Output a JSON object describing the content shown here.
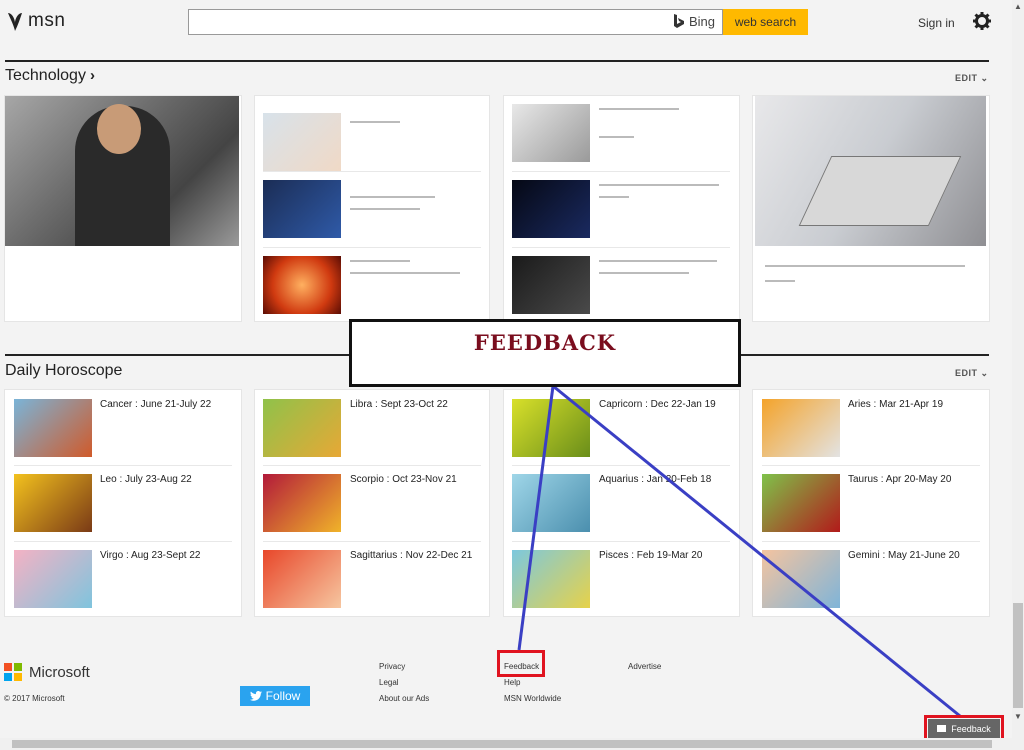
{
  "header": {
    "logo_text": "msn",
    "search_value": "",
    "bing_label": "Bing",
    "search_button": "web search",
    "signin": "Sign in"
  },
  "technology": {
    "title": "Technology",
    "edit": "EDIT"
  },
  "horoscope": {
    "title": "Daily Horoscope",
    "edit": "EDIT",
    "signs": [
      {
        "label": "Cancer : June 21-July 22"
      },
      {
        "label": "Leo : July 23-Aug 22"
      },
      {
        "label": "Virgo : Aug 23-Sept 22"
      },
      {
        "label": "Libra : Sept 23-Oct 22"
      },
      {
        "label": "Scorpio : Oct 23-Nov 21"
      },
      {
        "label": "Sagittarius : Nov 22-Dec 21"
      },
      {
        "label": "Capricorn : Dec 22-Jan 19"
      },
      {
        "label": "Aquarius : Jan 20-Feb 18"
      },
      {
        "label": "Pisces : Feb 19-Mar 20"
      },
      {
        "label": "Aries : Mar 21-Apr 19"
      },
      {
        "label": "Taurus : Apr 20-May 20"
      },
      {
        "label": "Gemini : May 21-June 20"
      }
    ]
  },
  "annotation": {
    "label": "FEEDBACK"
  },
  "footer": {
    "brand": "Microsoft",
    "copyright": "© 2017 Microsoft",
    "follow": "Follow",
    "links": {
      "privacy": "Privacy",
      "legal": "Legal",
      "about_ads": "About our Ads",
      "feedback": "Feedback",
      "help": "Help",
      "msn_worldwide": "MSN Worldwide",
      "advertise": "Advertise"
    },
    "feedback_button": "Feedback"
  },
  "colors": {
    "search_button": "#ffb900",
    "annotation_line": "#3a3fc4",
    "annotation_red": "#e0131f",
    "annotation_text": "#7a0d1e",
    "twitter": "#2aa3ef"
  }
}
